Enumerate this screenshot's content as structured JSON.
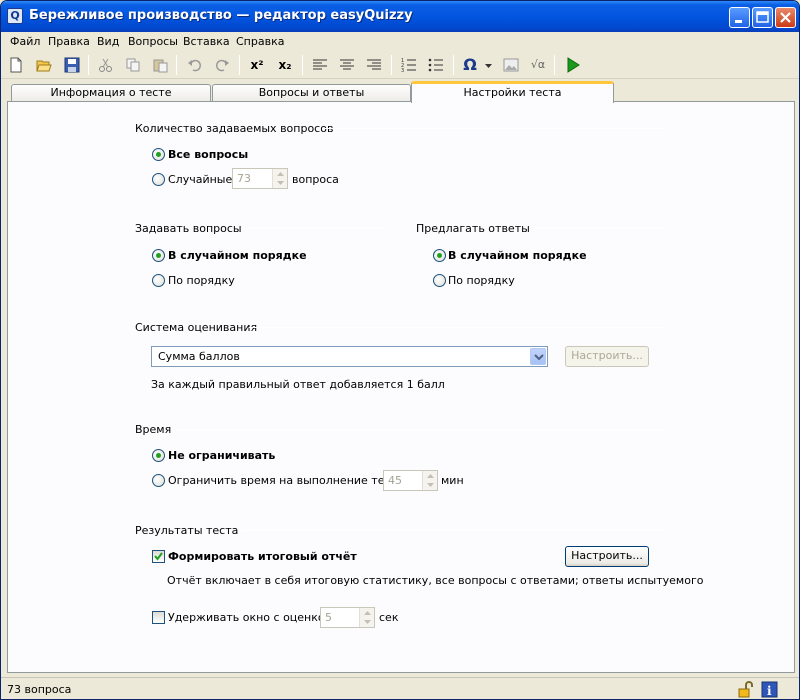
{
  "window": {
    "title": "Бережливое производство — редактор easyQuizzy",
    "app_icon_letter": "Q"
  },
  "menu": [
    "Файл",
    "Правка",
    "Вид",
    "Вопросы",
    "Вставка",
    "Справка"
  ],
  "toolbar": {
    "icons": [
      "new-document-icon",
      "open-folder-icon",
      "save-icon",
      "cut-icon",
      "copy-icon",
      "paste-icon",
      "undo-icon",
      "redo-icon",
      "superscript-icon",
      "subscript-icon",
      "align-left-icon",
      "align-center-icon",
      "align-right-icon",
      "numbered-list-icon",
      "bulleted-list-icon",
      "omega-symbol-icon",
      "dropdown-arrow-icon",
      "insert-image-icon",
      "insert-formula-icon",
      "run-test-icon"
    ],
    "superscript_label": "x²",
    "subscript_label": "x₂",
    "omega_label": "Ω",
    "formula_label": "√α"
  },
  "tabs": [
    {
      "label": "Информация о тесте",
      "active": false
    },
    {
      "label": "Вопросы и ответы",
      "active": false
    },
    {
      "label": "Настройки теста",
      "active": true
    }
  ],
  "settings": {
    "questions_count": {
      "label": "Количество задаваемых вопросов",
      "all_label": "Все вопросы",
      "random_label": "Случайные",
      "random_value": "73",
      "random_suffix": "вопроса"
    },
    "ask_questions": {
      "label": "Задавать вопросы",
      "random_order": "В случайном порядке",
      "in_order": "По порядку"
    },
    "offer_answers": {
      "label": "Предлагать ответы",
      "random_order": "В случайном порядке",
      "in_order": "По порядку"
    },
    "grading": {
      "label": "Система оценивания",
      "selected": "Сумма баллов",
      "configure_label": "Настроить...",
      "description": "За каждый правильный ответ добавляется 1 балл"
    },
    "time": {
      "label": "Время",
      "unlimited": "Не ограничивать",
      "limit_label": "Ограничить время на выполнение теста",
      "limit_value": "45",
      "limit_unit": "мин"
    },
    "results": {
      "label": "Результаты теста",
      "report_label": "Формировать итоговый отчёт",
      "report_checked": true,
      "configure_label": "Настроить...",
      "report_description": "Отчёт включает в себя итоговую статистику, все вопросы с ответами; ответы испытуемого",
      "hold_label": "Удерживать окно с оценкой",
      "hold_checked": false,
      "hold_value": "5",
      "hold_unit": "сек"
    }
  },
  "status": {
    "text": "73 вопроса"
  },
  "colors": {
    "titlebar": "#0355e0",
    "radio_dot": "#21a121",
    "tab_highlight": "#ffc83c",
    "run_icon": "#1a9a1a"
  }
}
